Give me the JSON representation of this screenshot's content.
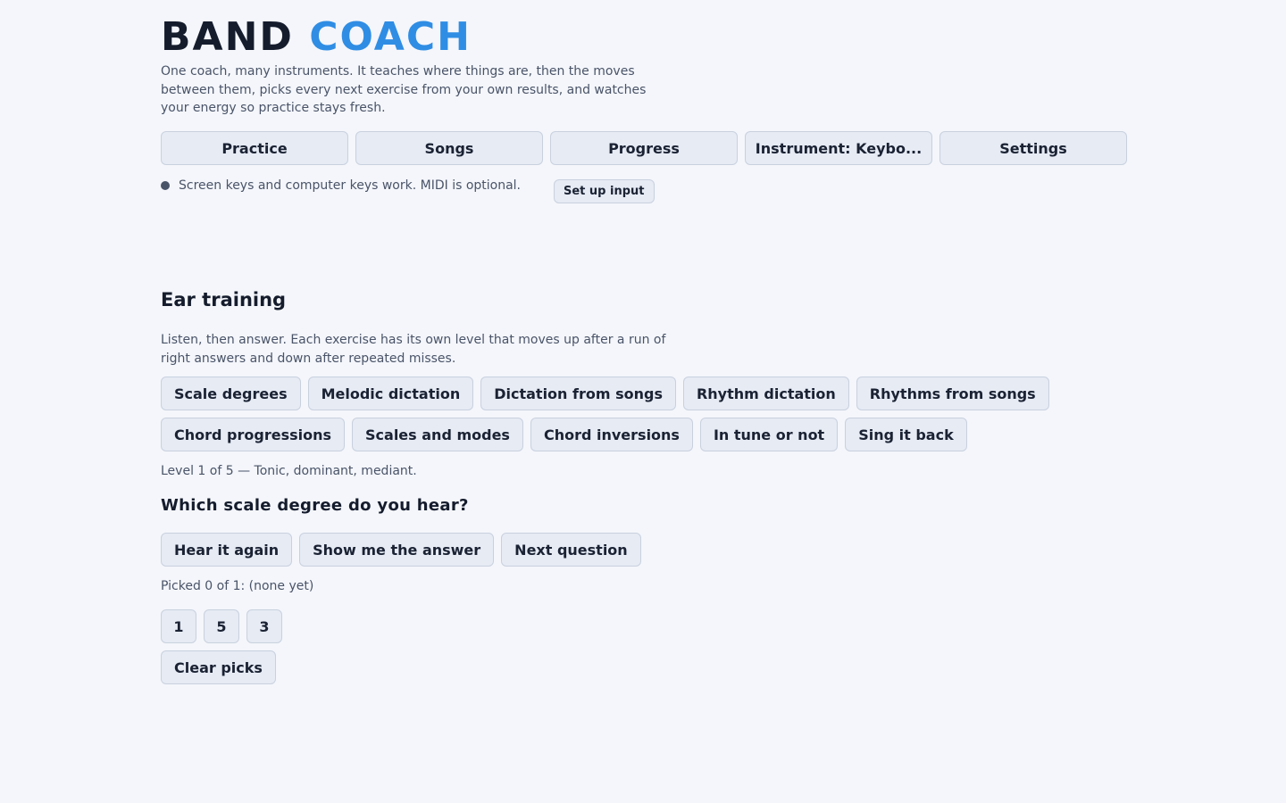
{
  "app": {
    "title_part1": "BAND",
    "title_part2": "COACH",
    "tagline": "One coach, many instruments. It teaches where things are, then the moves between them, picks every next exercise from your own results, and watches your energy so practice stays fresh.",
    "accent_color": "#2f8de4"
  },
  "nav": {
    "items": [
      {
        "label": "Practice"
      },
      {
        "label": "Songs"
      },
      {
        "label": "Progress"
      },
      {
        "label": "Instrument: Keybo..."
      },
      {
        "label": "Settings"
      }
    ]
  },
  "input_status": {
    "icon": "status-dot-icon",
    "text": "Screen keys and computer keys work. MIDI is optional.",
    "button_label": "Set up input"
  },
  "ear_training": {
    "title": "Ear training",
    "description": "Listen, then answer. Each exercise has its own level that moves up after a run of right answers and down after repeated misses.",
    "exercises_row1": [
      {
        "label": "Scale degrees"
      },
      {
        "label": "Melodic dictation"
      },
      {
        "label": "Dictation from songs"
      },
      {
        "label": "Rhythm dictation"
      },
      {
        "label": "Rhythms from songs"
      }
    ],
    "exercises_row2": [
      {
        "label": "Chord progressions"
      },
      {
        "label": "Scales and modes"
      },
      {
        "label": "Chord inversions"
      },
      {
        "label": "In tune or not"
      },
      {
        "label": "Sing it back"
      }
    ],
    "level_text": "Level 1 of 5 — Tonic, dominant, mediant.",
    "question": "Which scale degree do you hear?",
    "actions": {
      "hear_again": "Hear it again",
      "show_answer": "Show me the answer",
      "next_question": "Next question"
    },
    "picked_text": "Picked 0 of 1: (none yet)",
    "answers": [
      "1",
      "5",
      "3"
    ],
    "clear_label": "Clear picks"
  }
}
